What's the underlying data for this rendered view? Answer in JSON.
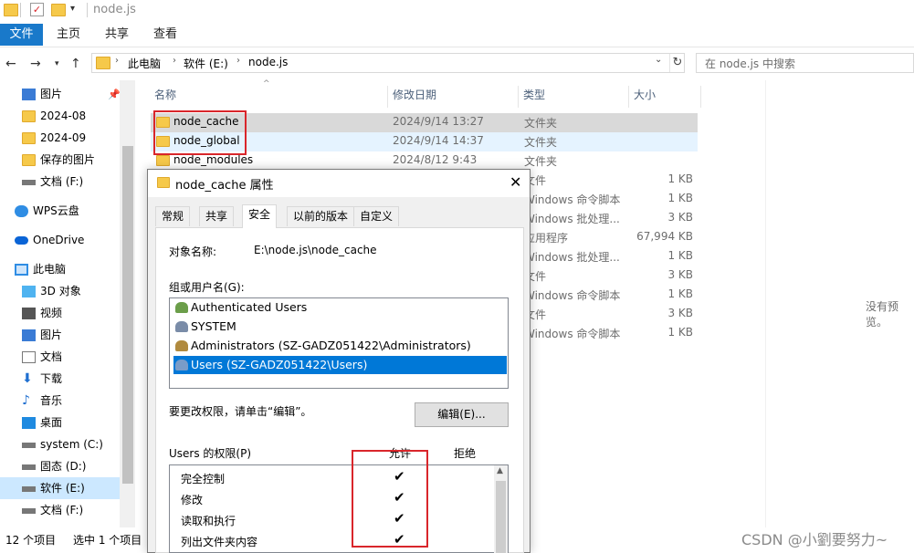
{
  "window": {
    "title": "node.js"
  },
  "ribbon": {
    "file": "文件",
    "tabs": [
      "主页",
      "共享",
      "查看"
    ]
  },
  "address": {
    "crumbs": [
      "此电脑",
      "软件 (E:)",
      "node.js"
    ],
    "search_placeholder": "在 node.js 中搜索"
  },
  "sidebar": {
    "items": [
      {
        "label": "图片",
        "icon": "pictures-icon"
      },
      {
        "label": "2024-08",
        "icon": "folder-icon"
      },
      {
        "label": "2024-09",
        "icon": "folder-icon"
      },
      {
        "label": "保存的图片",
        "icon": "folder-icon"
      },
      {
        "label": "文档 (F:)",
        "icon": "drive-icon"
      },
      {
        "label": "WPS云盘",
        "icon": "cloud-icon"
      },
      {
        "label": "OneDrive",
        "icon": "onedrive-icon"
      },
      {
        "label": "此电脑",
        "icon": "computer-icon"
      },
      {
        "label": "3D 对象",
        "icon": "3d-objects-icon"
      },
      {
        "label": "视频",
        "icon": "video-icon"
      },
      {
        "label": "图片",
        "icon": "pictures-icon"
      },
      {
        "label": "文档",
        "icon": "documents-icon"
      },
      {
        "label": "下载",
        "icon": "download-icon"
      },
      {
        "label": "音乐",
        "icon": "music-icon"
      },
      {
        "label": "桌面",
        "icon": "desktop-icon"
      },
      {
        "label": "system (C:)",
        "icon": "drive-icon"
      },
      {
        "label": "固态 (D:)",
        "icon": "drive-icon"
      },
      {
        "label": "软件 (E:)",
        "icon": "drive-icon"
      },
      {
        "label": "文档 (F:)",
        "icon": "drive-icon"
      }
    ]
  },
  "filelist": {
    "columns": [
      "名称",
      "修改日期",
      "类型",
      "大小"
    ],
    "rows": [
      {
        "name": "node_cache",
        "date": "2024/9/14 13:27",
        "type": "文件夹",
        "size": ""
      },
      {
        "name": "node_global",
        "date": "2024/9/14 14:37",
        "type": "文件夹",
        "size": ""
      },
      {
        "name": "node_modules",
        "date": "2024/8/12 9:43",
        "type": "文件夹",
        "size": ""
      }
    ],
    "partial_rows": [
      {
        "type": "文件",
        "size": "1 KB"
      },
      {
        "type": "Windows 命令脚本",
        "size": "1 KB"
      },
      {
        "type": "Windows 批处理...",
        "size": "3 KB"
      },
      {
        "type": "应用程序",
        "size": "67,994 KB"
      },
      {
        "type": "Windows 批处理...",
        "size": "1 KB"
      },
      {
        "type": "文件",
        "size": "3 KB"
      },
      {
        "type": "Windows 命令脚本",
        "size": "1 KB"
      },
      {
        "type": "文件",
        "size": "3 KB"
      },
      {
        "type": "Windows 命令脚本",
        "size": "1 KB"
      }
    ]
  },
  "preview": {
    "text": "没有预览。"
  },
  "status": {
    "count": "12 个项目",
    "selected": "选中 1 个项目"
  },
  "watermark": "CSDN @小劉要努力~",
  "dialog": {
    "title": "node_cache 属性",
    "tabs": [
      "常规",
      "共享",
      "安全",
      "以前的版本",
      "自定义"
    ],
    "object_label": "对象名称:",
    "object_value": "E:\\node.js\\node_cache",
    "group_label": "组或用户名(G):",
    "groups": [
      "Authenticated Users",
      "SYSTEM",
      "Administrators (SZ-GADZ051422\\Administrators)",
      "Users (SZ-GADZ051422\\Users)"
    ],
    "change_hint": "要更改权限，请单击“编辑”。",
    "edit_button": "编辑(E)...",
    "perm_label": "Users 的权限(P)",
    "allow": "允许",
    "deny": "拒绝",
    "permissions": [
      "完全控制",
      "修改",
      "读取和执行",
      "列出文件夹内容"
    ],
    "check": "✔"
  },
  "colors": {
    "accent": "#1979ca",
    "selection": "#0078d7",
    "highlight_box": "#d9262b"
  }
}
